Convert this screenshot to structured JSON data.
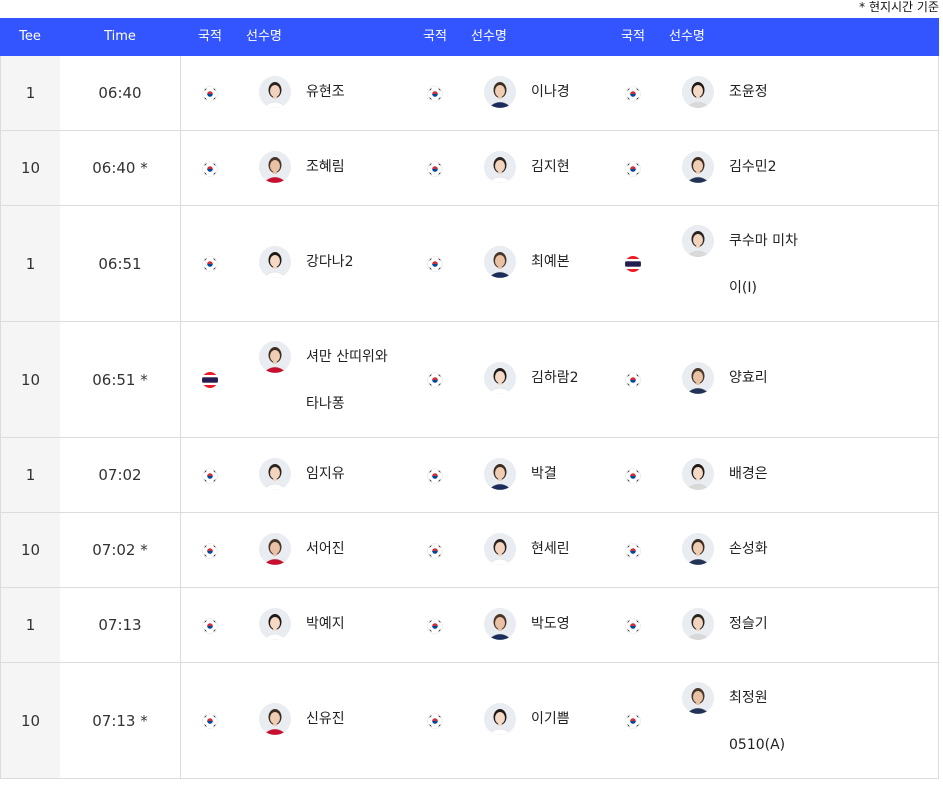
{
  "note": "* 현지시간 기준",
  "header": {
    "tee": "Tee",
    "time": "Time",
    "nationality": "국적",
    "player_name": "선수명"
  },
  "colors": {
    "header_bg": "#3355ff",
    "tee_bg": "#f5f5f5",
    "border": "#dcdcdc"
  },
  "rows": [
    {
      "tee": "1",
      "time": "06:40",
      "players": [
        {
          "flag": "korea-flag-icon",
          "name": [
            "유현조"
          ],
          "avatar": "player-photo"
        },
        {
          "flag": "korea-flag-icon",
          "name": [
            "이나경"
          ],
          "avatar": "player-photo"
        },
        {
          "flag": "korea-flag-icon",
          "name": [
            "조윤정"
          ],
          "avatar": "player-photo"
        }
      ]
    },
    {
      "tee": "10",
      "time": "06:40 *",
      "players": [
        {
          "flag": "korea-flag-icon",
          "name": [
            "조혜림"
          ],
          "avatar": "player-photo"
        },
        {
          "flag": "korea-flag-icon",
          "name": [
            "김지현"
          ],
          "avatar": "player-photo"
        },
        {
          "flag": "korea-flag-icon",
          "name": [
            "김수민2"
          ],
          "avatar": "player-photo"
        }
      ]
    },
    {
      "tee": "1",
      "time": "06:51",
      "players": [
        {
          "flag": "korea-flag-icon",
          "name": [
            "강다나2"
          ],
          "avatar": "player-photo"
        },
        {
          "flag": "korea-flag-icon",
          "name": [
            "최예본"
          ],
          "avatar": "player-photo"
        },
        {
          "flag": "thailand-flag-icon",
          "name": [
            "쿠수마 미차",
            "이(I)"
          ],
          "avatar": "player-photo"
        }
      ]
    },
    {
      "tee": "10",
      "time": "06:51 *",
      "players": [
        {
          "flag": "thailand-flag-icon",
          "name": [
            "셔만 산띠위와",
            "타나퐁"
          ],
          "avatar": "player-photo"
        },
        {
          "flag": "korea-flag-icon",
          "name": [
            "김하람2"
          ],
          "avatar": "player-photo"
        },
        {
          "flag": "korea-flag-icon",
          "name": [
            "양효리"
          ],
          "avatar": "player-photo"
        }
      ]
    },
    {
      "tee": "1",
      "time": "07:02",
      "players": [
        {
          "flag": "korea-flag-icon",
          "name": [
            "임지유"
          ],
          "avatar": "player-photo"
        },
        {
          "flag": "korea-flag-icon",
          "name": [
            "박결"
          ],
          "avatar": "player-photo"
        },
        {
          "flag": "korea-flag-icon",
          "name": [
            "배경은"
          ],
          "avatar": "player-photo"
        }
      ]
    },
    {
      "tee": "10",
      "time": "07:02 *",
      "players": [
        {
          "flag": "korea-flag-icon",
          "name": [
            "서어진"
          ],
          "avatar": "player-photo"
        },
        {
          "flag": "korea-flag-icon",
          "name": [
            "현세린"
          ],
          "avatar": "player-photo"
        },
        {
          "flag": "korea-flag-icon",
          "name": [
            "손성화"
          ],
          "avatar": "player-photo"
        }
      ]
    },
    {
      "tee": "1",
      "time": "07:13",
      "players": [
        {
          "flag": "korea-flag-icon",
          "name": [
            "박예지"
          ],
          "avatar": "player-photo"
        },
        {
          "flag": "korea-flag-icon",
          "name": [
            "박도영"
          ],
          "avatar": "player-photo"
        },
        {
          "flag": "korea-flag-icon",
          "name": [
            "정슬기"
          ],
          "avatar": "player-photo"
        }
      ]
    },
    {
      "tee": "10",
      "time": "07:13 *",
      "players": [
        {
          "flag": "korea-flag-icon",
          "name": [
            "신유진"
          ],
          "avatar": "player-photo"
        },
        {
          "flag": "korea-flag-icon",
          "name": [
            "이기쁨"
          ],
          "avatar": "player-photo"
        },
        {
          "flag": "korea-flag-icon",
          "name": [
            "최정원",
            "0510(A)"
          ],
          "avatar": "player-photo"
        }
      ]
    }
  ]
}
